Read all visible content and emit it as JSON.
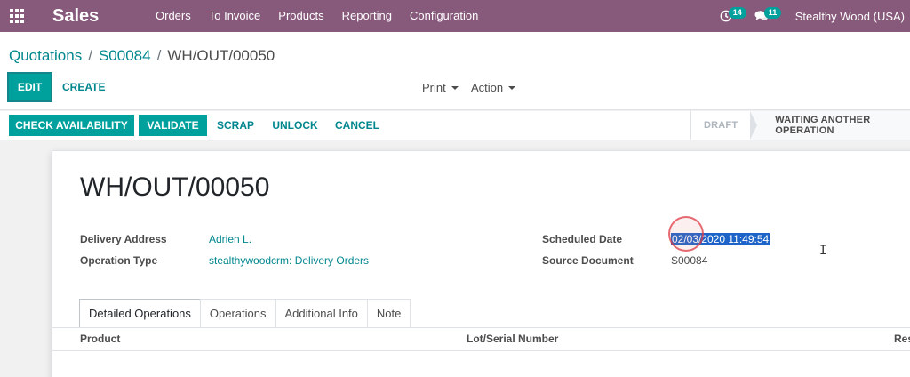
{
  "navbar": {
    "app_name": "Sales",
    "menu": [
      "Orders",
      "To Invoice",
      "Products",
      "Reporting",
      "Configuration"
    ],
    "activity_count": "14",
    "messages_count": "11",
    "company": "Stealthy Wood (USA)"
  },
  "breadcrumb": {
    "root": "Quotations",
    "parent": "S00084",
    "current": "WH/OUT/00050"
  },
  "control": {
    "edit": "EDIT",
    "create": "CREATE",
    "print": "Print",
    "action": "Action"
  },
  "status": {
    "buttons": [
      "CHECK AVAILABILITY",
      "VALIDATE",
      "SCRAP",
      "UNLOCK",
      "CANCEL"
    ],
    "stages": [
      "DRAFT",
      "WAITING ANOTHER OPERATION"
    ]
  },
  "form": {
    "title": "WH/OUT/00050",
    "delivery_address_label": "Delivery Address",
    "delivery_address": "Adrien L.",
    "operation_type_label": "Operation Type",
    "operation_type": "stealthywoodcrm: Delivery Orders",
    "scheduled_date_label": "Scheduled Date",
    "scheduled_date": "02/03/2020 11:49:54",
    "source_document_label": "Source Document",
    "source_document": "S00084"
  },
  "tabs": [
    "Detailed Operations",
    "Operations",
    "Additional Info",
    "Note"
  ],
  "table": {
    "columns": [
      "Product",
      "Lot/Serial Number",
      "Res"
    ]
  },
  "colors": {
    "navbar": "#875a7b",
    "primary": "#00a09d",
    "link": "#00878e",
    "selection": "#1e64c8"
  }
}
